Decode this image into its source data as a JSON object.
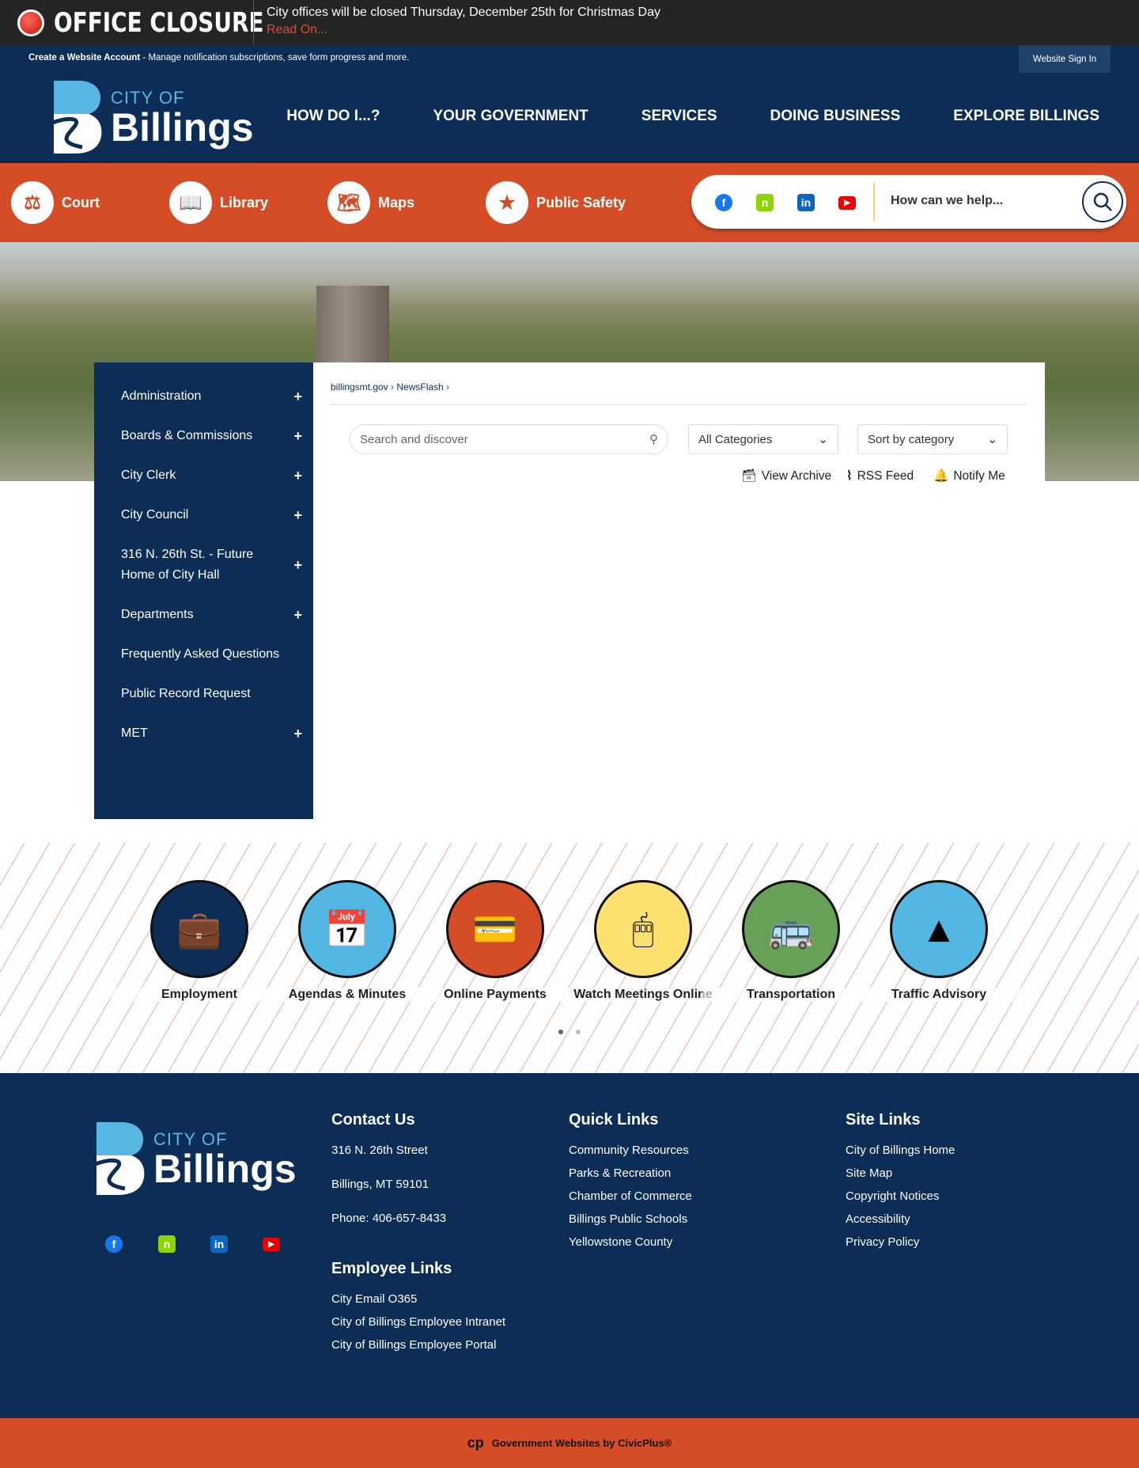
{
  "alert": {
    "title": "OFFICE CLOSURE",
    "message": "City offices will be closed Thursday, December 25th for Christmas Day",
    "link": "Read On..."
  },
  "account": {
    "create": "Create a Website Account",
    "desc": " - Manage notification subscriptions, save form progress and more.",
    "sign_in": "Website Sign In"
  },
  "logo": {
    "city_of": "CITY OF",
    "name": "Billings"
  },
  "nav": [
    "HOW DO I...?",
    "YOUR GOVERNMENT",
    "SERVICES",
    "DOING BUSINESS",
    "EXPLORE BILLINGS"
  ],
  "quick_nav": [
    {
      "label": "Court",
      "icon": "gavel-icon"
    },
    {
      "label": "Library",
      "icon": "book-icon"
    },
    {
      "label": "Maps",
      "icon": "map-icon"
    },
    {
      "label": "Public Safety",
      "icon": "badge-icon"
    }
  ],
  "search": {
    "placeholder": "How can we help..."
  },
  "social": [
    "facebook",
    "nextdoor",
    "linkedin",
    "youtube"
  ],
  "sidebar": [
    "Administration",
    "Boards & Commissions",
    "City Clerk",
    "City Council",
    "316 N. 26th St. - Future Home of City Hall",
    "Departments",
    "Frequently Asked Questions",
    "Public Record Request",
    "MET"
  ],
  "breadcrumb": [
    "billingsmt.gov",
    "NewsFlash"
  ],
  "filters": {
    "search_placeholder": "Search and discover",
    "category": "All Categories",
    "sort": "Sort by category"
  },
  "actions": [
    "View Archive",
    "RSS Feed",
    "Notify Me"
  ],
  "tiles": [
    {
      "label": "Employment",
      "color": "#0c2d55"
    },
    {
      "label": "Agendas & Minutes",
      "color": "#52b6e3"
    },
    {
      "label": "Online Payments",
      "color": "#d44d27"
    },
    {
      "label": "Watch Meetings Online",
      "color": "#fde06f"
    },
    {
      "label": "Transportation",
      "color": "#66a157"
    },
    {
      "label": "Traffic Advisory",
      "color": "#52b6e3"
    }
  ],
  "footer": {
    "contact": {
      "title": "Contact Us",
      "address1": "316 N. 26th Street",
      "address2": "Billings, MT 59101",
      "phone": "Phone: 406-657-8433"
    },
    "employee": {
      "title": "Employee Links",
      "links": [
        "City Email O365",
        "City of Billings Employee Intranet",
        "City of Billings Employee Portal"
      ]
    },
    "quick": {
      "title": "Quick Links",
      "links": [
        "Community Resources",
        "Parks & Recreation",
        "Chamber of Commerce",
        "Billings Public Schools",
        "Yellowstone County"
      ]
    },
    "site": {
      "title": "Site Links",
      "links": [
        "City of Billings Home",
        "Site Map",
        "Copyright Notices",
        "Accessibility",
        "Privacy Policy"
      ]
    }
  },
  "credit": "Government Websites by CivicPlus®"
}
